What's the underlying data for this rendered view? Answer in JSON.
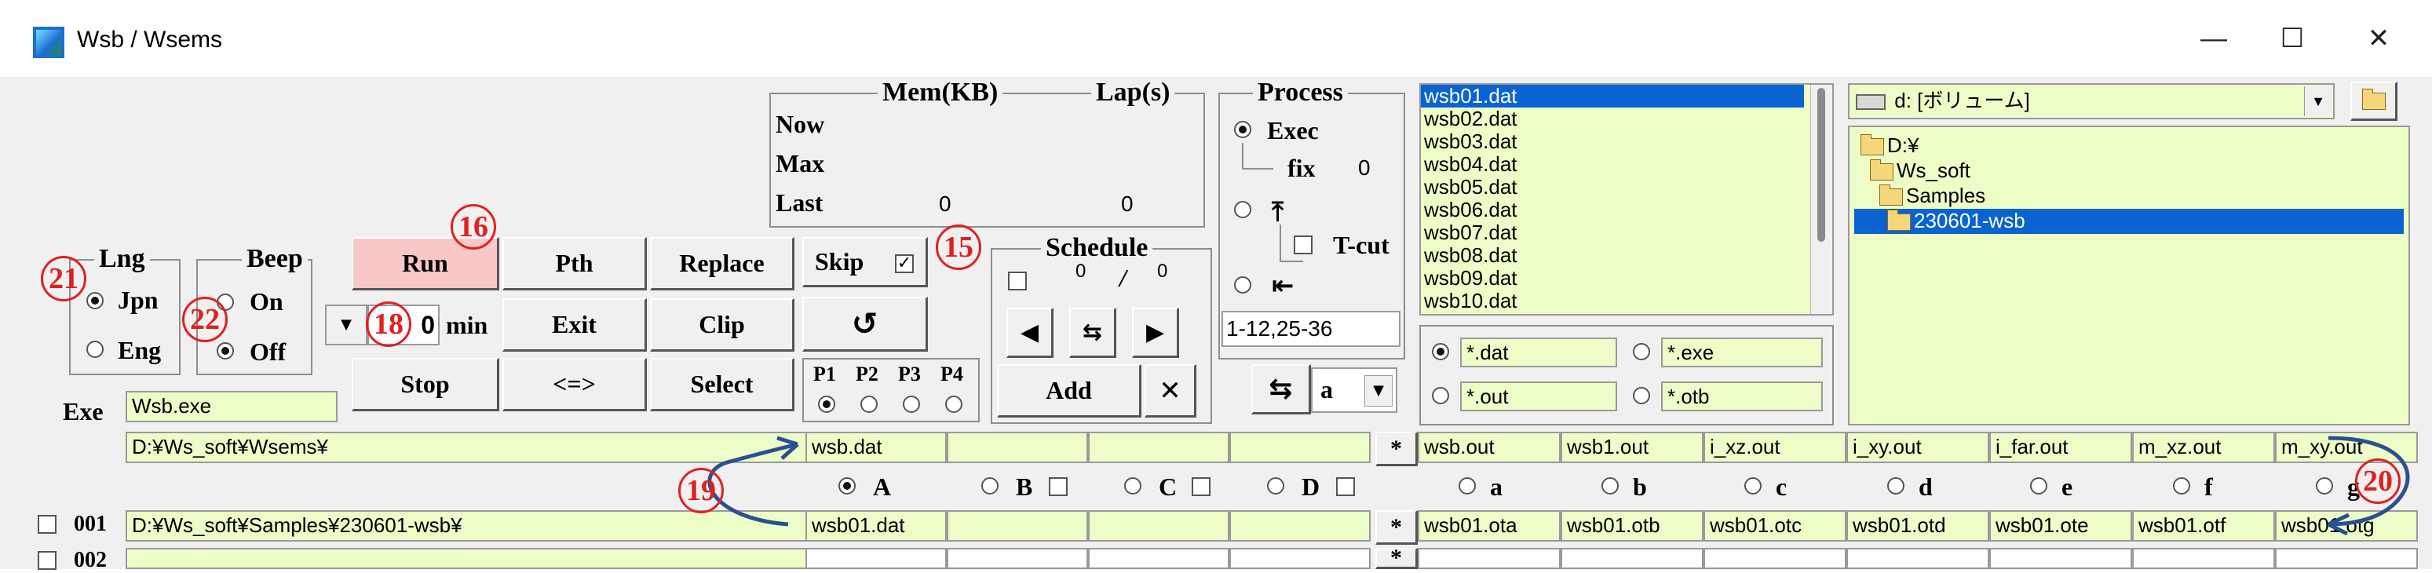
{
  "window": {
    "title": "Wsb / Wsems",
    "controls": {
      "minimize": "—",
      "maximize": "☐",
      "close": "✕"
    }
  },
  "status": {
    "mem_label": "Mem(KB)",
    "lap_label": "Lap(s)",
    "rows": [
      {
        "label": "Now",
        "mem": "",
        "lap": ""
      },
      {
        "label": "Max",
        "mem": "",
        "lap": ""
      },
      {
        "label": "Last",
        "mem": "0",
        "lap": "0"
      }
    ]
  },
  "process": {
    "title": "Process",
    "exec_label": "Exec",
    "fix_label": "fix",
    "fix_value": "0",
    "tcut_label": "T-cut",
    "range_value": "1-12,25-36"
  },
  "lng": {
    "title": "Lng",
    "jpn": "Jpn",
    "eng": "Eng"
  },
  "beep": {
    "title": "Beep",
    "on": "On",
    "off": "Off"
  },
  "buttons": {
    "run": "Run",
    "pth": "Pth",
    "replace": "Replace",
    "exit": "Exit",
    "clip": "Clip",
    "stop": "Stop",
    "swap": "<=>",
    "select": "Select",
    "skip": "Skip",
    "refresh": "↺",
    "min_unit": "min"
  },
  "timer_value": "0",
  "priority": {
    "labels": [
      "P1",
      "P2",
      "P3",
      "P4"
    ]
  },
  "schedule": {
    "title": "Schedule",
    "count_a": "0",
    "sep": "/",
    "count_b": "0",
    "add_label": "Add",
    "delete_label": "✕"
  },
  "mode_select": {
    "value": "a",
    "swap_icon": "⇆"
  },
  "files": [
    "wsb01.dat",
    "wsb02.dat",
    "wsb03.dat",
    "wsb04.dat",
    "wsb05.dat",
    "wsb06.dat",
    "wsb07.dat",
    "wsb08.dat",
    "wsb09.dat",
    "wsb10.dat"
  ],
  "filters": [
    "*.dat",
    "*.exe",
    "*.out",
    "*.otb"
  ],
  "drive": {
    "value": "d: [ボリューム]"
  },
  "tree": [
    "D:¥",
    "Ws_soft",
    "Samples",
    "230601-wsb"
  ],
  "exe": {
    "label": "Exe",
    "value": "Wsb.exe",
    "path": "D:¥Ws_soft¥Wsems¥"
  },
  "input_files": [
    "wsb.dat",
    "",
    "",
    ""
  ],
  "output_files": [
    "wsb.out",
    "wsb1.out",
    "i_xz.out",
    "i_xy.out",
    "i_far.out",
    "m_xz.out",
    "m_xy.out"
  ],
  "input_tabs": [
    "A",
    "B",
    "C",
    "D"
  ],
  "output_tabs": [
    "a",
    "b",
    "c",
    "d",
    "e",
    "f",
    "g"
  ],
  "star": "*",
  "rows": [
    {
      "no": "001",
      "path": "D:¥Ws_soft¥Samples¥230601-wsb¥",
      "inputs": [
        "wsb01.dat",
        "",
        "",
        ""
      ],
      "outputs": [
        "wsb01.ota",
        "wsb01.otb",
        "wsb01.otc",
        "wsb01.otd",
        "wsb01.ote",
        "wsb01.otf",
        "wsb01.otg"
      ]
    },
    {
      "no": "002",
      "path": "",
      "inputs": [
        "",
        "",
        "",
        ""
      ],
      "outputs": [
        "",
        "",
        "",
        "",
        "",
        "",
        ""
      ]
    }
  ],
  "annotations": [
    "15",
    "16",
    "18",
    "19",
    "20",
    "21",
    "22"
  ],
  "colors": {
    "field": "#edfdc8",
    "run": "#f8c7c8",
    "badge": "#e02020",
    "selection": "#0a63d1",
    "arrow": "#2b4f8f"
  }
}
